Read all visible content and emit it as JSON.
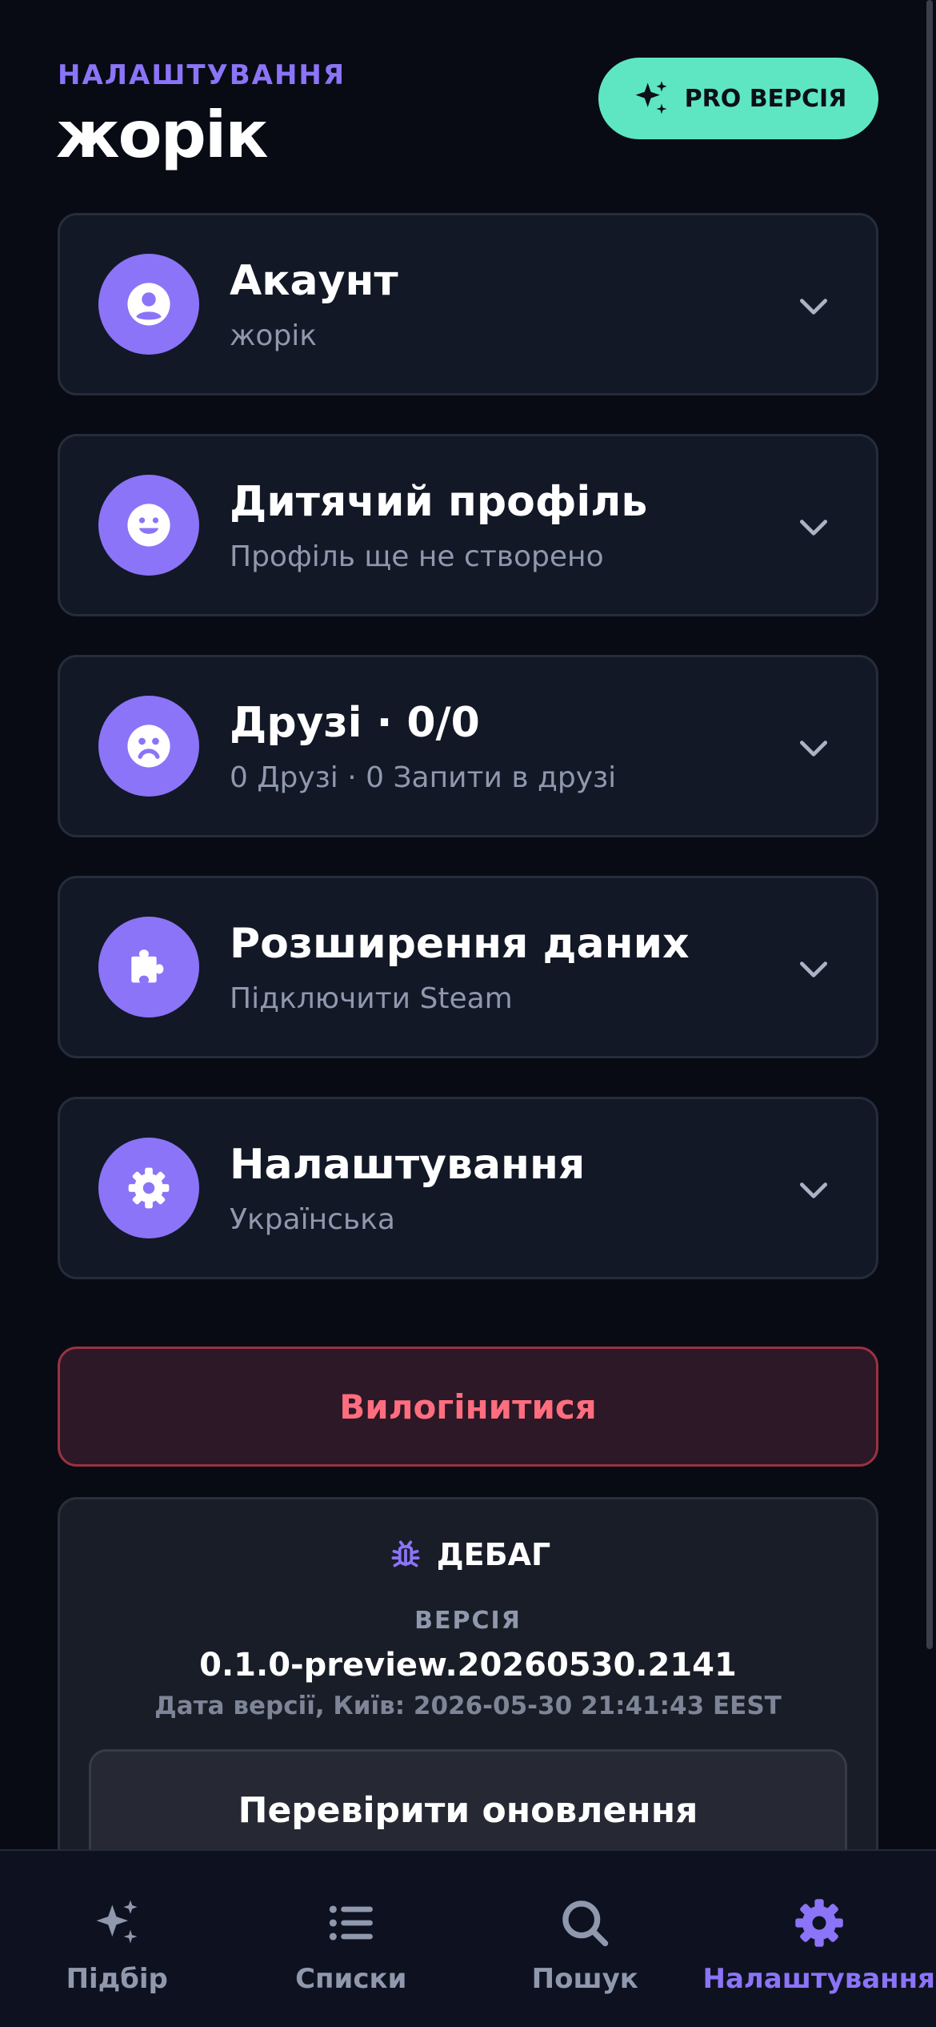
{
  "header": {
    "eyebrow": "НАЛАШТУВАННЯ",
    "title": "жорік",
    "pro_button": "PRO ВЕРСІЯ"
  },
  "sections": [
    {
      "title": "Акаунт",
      "subtitle": "жорік",
      "icon": "user-circle-icon"
    },
    {
      "title": "Дитячий профіль",
      "subtitle": "Профіль ще не створено",
      "icon": "smile-face-icon"
    },
    {
      "title": "Друзі · 0/0",
      "subtitle": "0 Друзі · 0 Запити в друзі",
      "icon": "friends-face-icon"
    },
    {
      "title": "Розширення даних",
      "subtitle": "Підключити Steam",
      "icon": "puzzle-icon"
    },
    {
      "title": "Налаштування",
      "subtitle": "Українська",
      "icon": "gear-icon"
    }
  ],
  "logout_label": "Вилогінитися",
  "debug": {
    "title": "ДЕБАГ",
    "version_label": "ВЕРСІЯ",
    "version": "0.1.0-preview.20260530.2141",
    "build_date": "Дата версії, Київ: 2026-05-30 21:41:43 EEST",
    "check_updates": "Перевірити оновлення"
  },
  "nav": [
    {
      "label": "Підбір",
      "icon": "sparkles-icon",
      "active": false
    },
    {
      "label": "Списки",
      "icon": "list-icon",
      "active": false
    },
    {
      "label": "Пошук",
      "icon": "search-icon",
      "active": false
    },
    {
      "label": "Налаштування",
      "icon": "gear-icon",
      "active": true
    }
  ],
  "colors": {
    "background": "#080b14",
    "accent": "#8b74f7",
    "pro": "#5ee6c3",
    "danger": "#ff6e7f"
  }
}
